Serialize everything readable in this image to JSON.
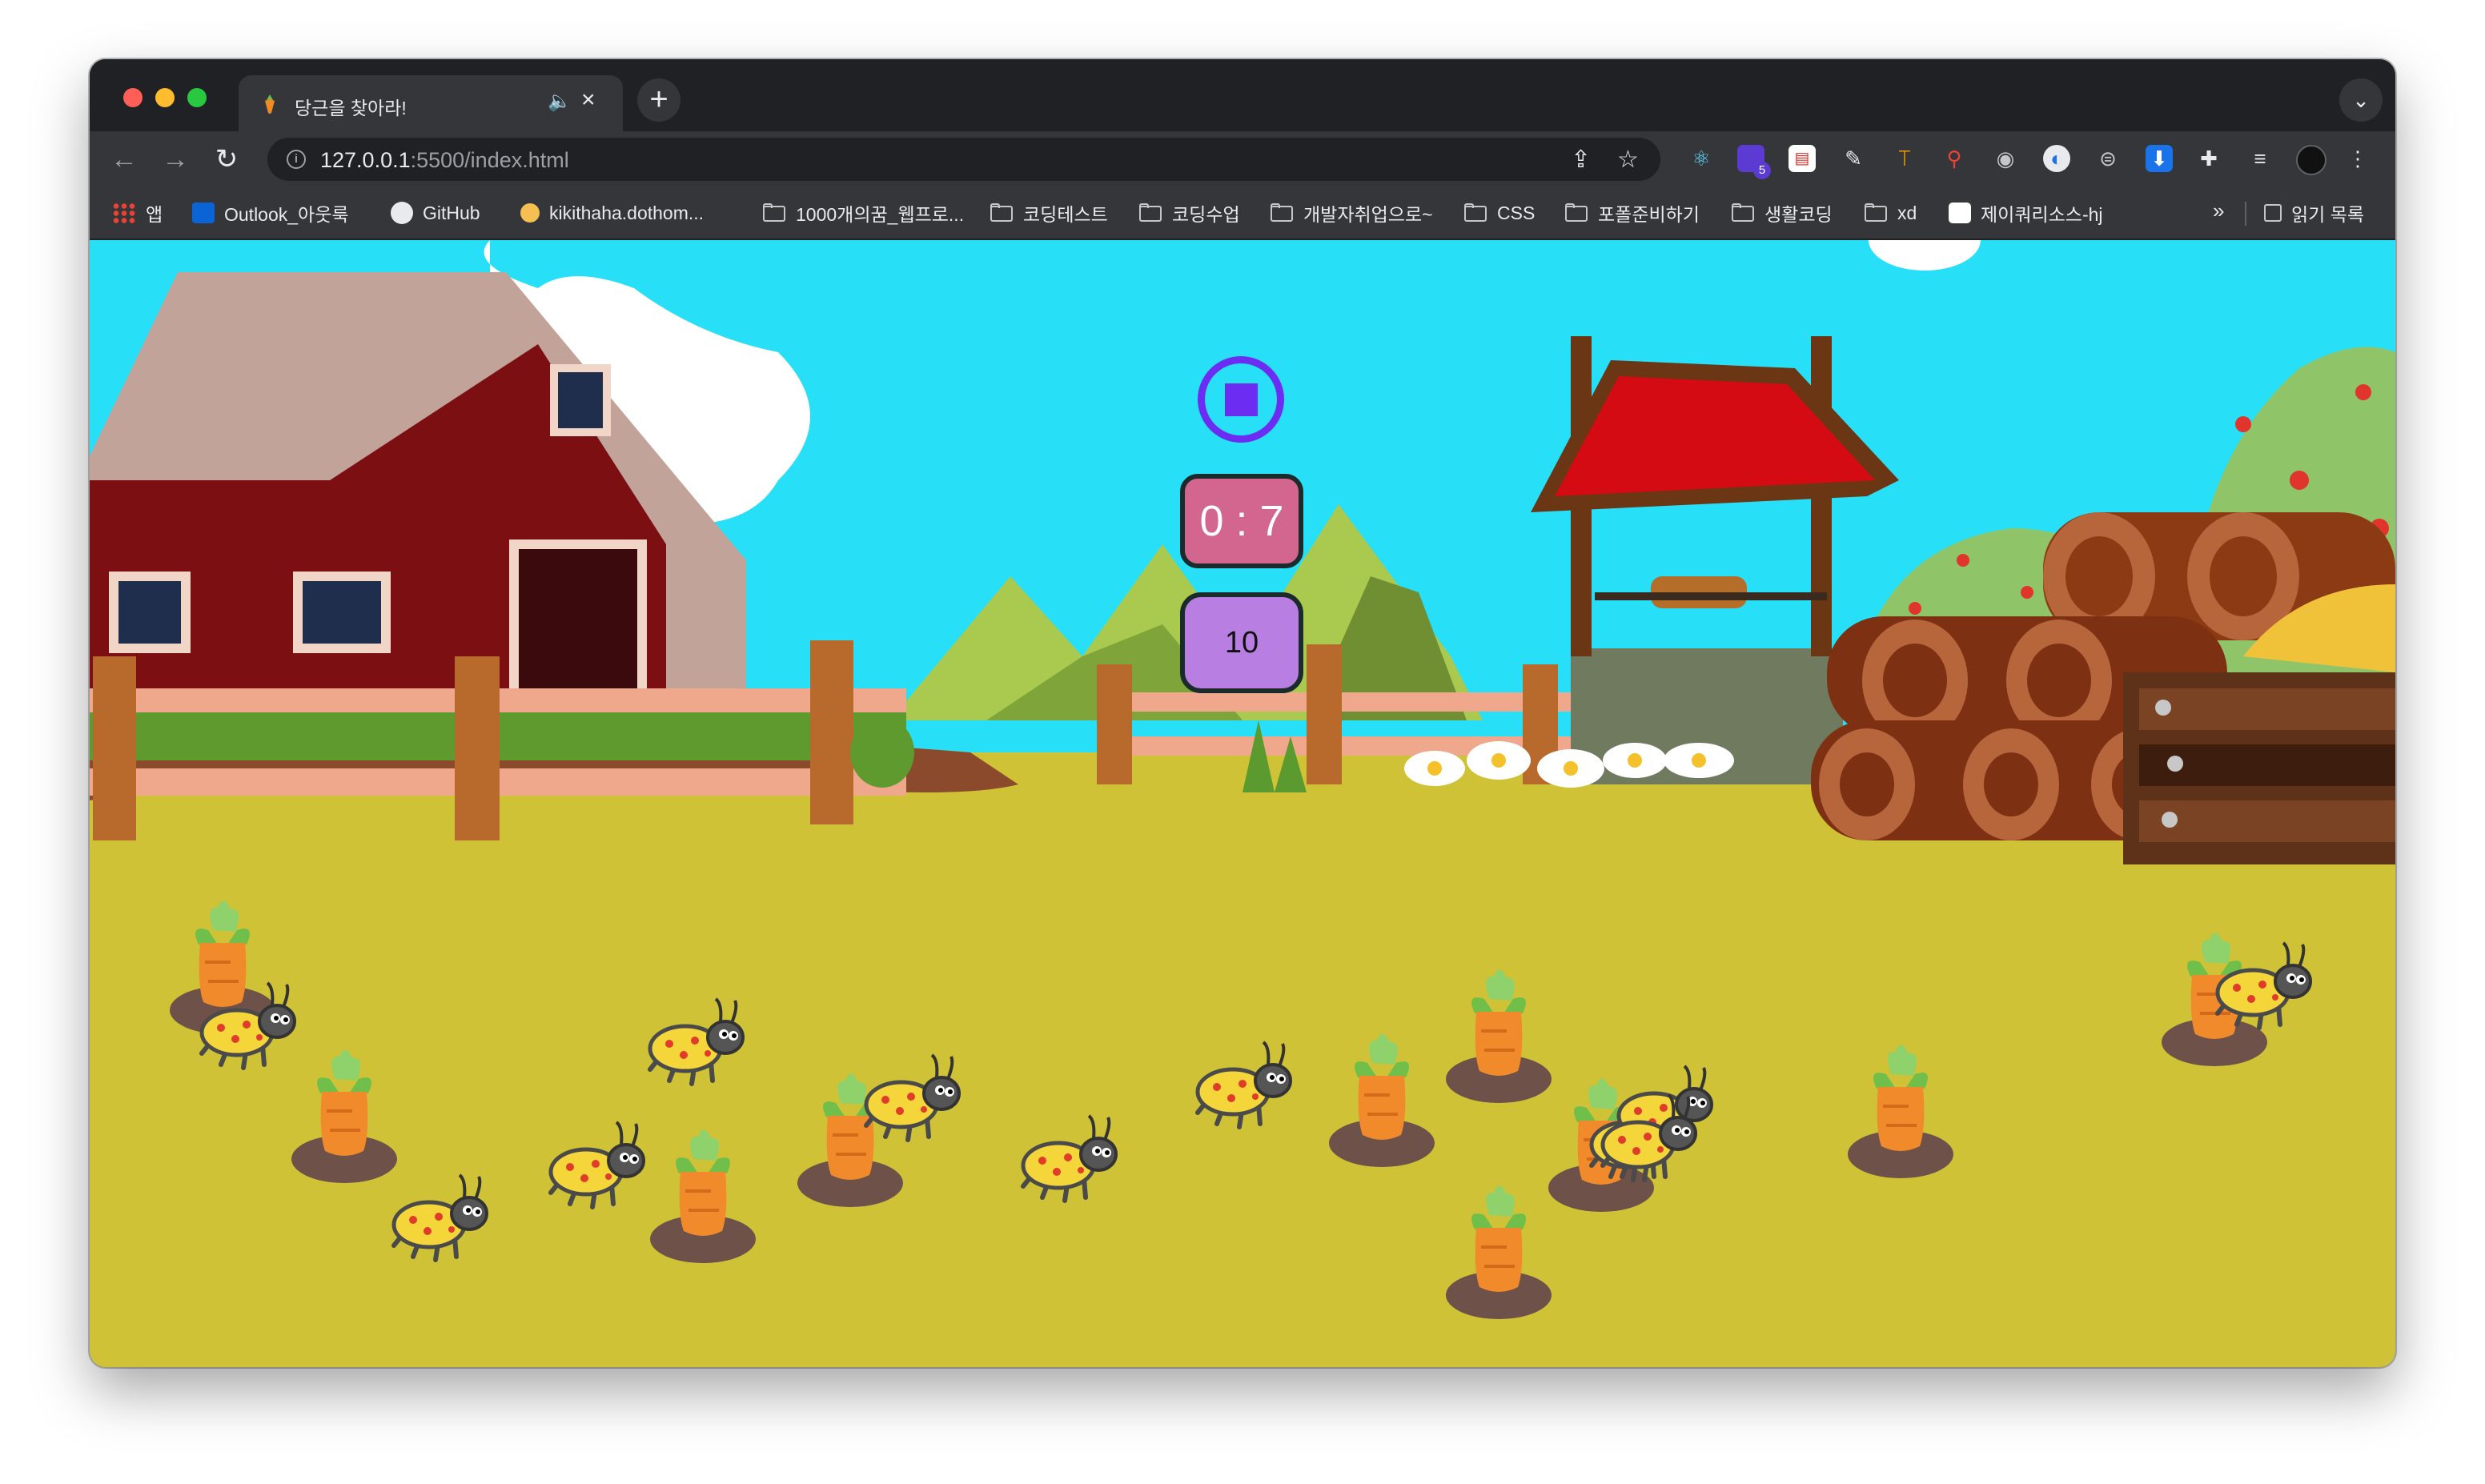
{
  "browser": {
    "tab": {
      "title": "당근을 찾아라!"
    },
    "url": {
      "host": "127.0.0.1",
      "rest": ":5500/index.html"
    },
    "bookmarks": [
      {
        "label": "앱",
        "icon": "apps-grid-icon"
      },
      {
        "label": "Outlook_아웃룩",
        "icon": "outlook-icon"
      },
      {
        "label": "GitHub",
        "icon": "github-icon"
      },
      {
        "label": "kikithaha.dothom...",
        "icon": "site-icon"
      },
      {
        "label": "1000개의꿈_웹프로...",
        "icon": "folder-icon"
      },
      {
        "label": "코딩테스트",
        "icon": "folder-icon"
      },
      {
        "label": "코딩수업",
        "icon": "folder-icon"
      },
      {
        "label": "개발자취업으로~",
        "icon": "folder-icon"
      },
      {
        "label": "CSS",
        "icon": "folder-icon"
      },
      {
        "label": "포폴준비하기",
        "icon": "folder-icon"
      },
      {
        "label": "생활코딩",
        "icon": "folder-icon"
      },
      {
        "label": "xd",
        "icon": "folder-icon"
      },
      {
        "label": "제이쿼리소스-hj",
        "icon": "site-icon"
      }
    ],
    "overflow_label": "»",
    "reading_list_label": "읽기 목록",
    "extension_badge": "5"
  },
  "game": {
    "control_button_icon": "stop-icon",
    "timer": "0 : 7",
    "carrots_left": "10",
    "carrot_count": 10,
    "bug_count": 11
  },
  "colors": {
    "sky": "#27e0f7",
    "field": "#d0c236",
    "play_button": "#6d2cf2",
    "timer_bg": "#d3668e",
    "score_bg": "#b97ee2"
  }
}
